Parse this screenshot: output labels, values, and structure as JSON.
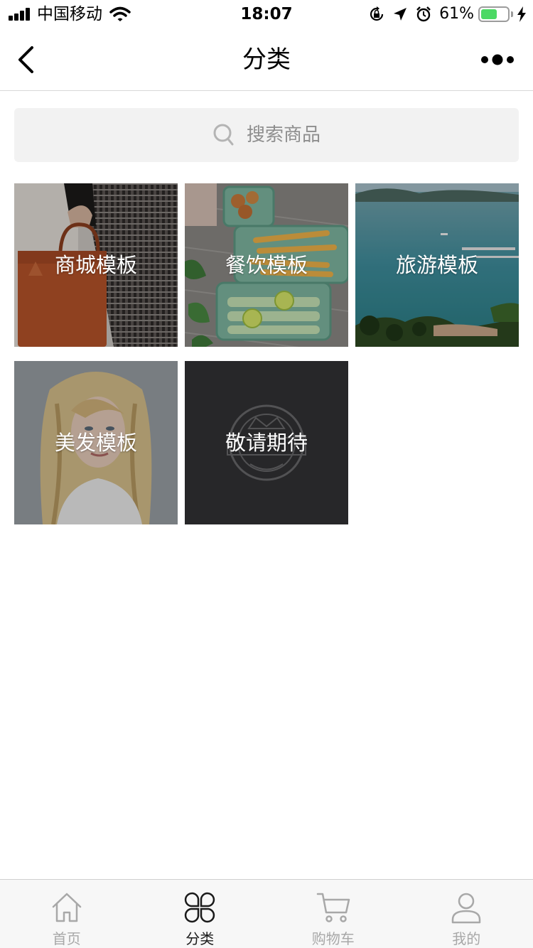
{
  "status_bar": {
    "carrier": "中国移动",
    "time": "18:07",
    "battery": "61%",
    "battery_level": 0.61
  },
  "nav": {
    "title": "分类"
  },
  "search": {
    "placeholder": "搜索商品"
  },
  "categories": [
    {
      "label": "商城模板"
    },
    {
      "label": "餐饮模板"
    },
    {
      "label": "旅游模板"
    },
    {
      "label": "美发模板"
    },
    {
      "label": "敬请期待"
    }
  ],
  "tab_bar": {
    "items": [
      {
        "label": "首页",
        "icon": "home-icon",
        "active": false
      },
      {
        "label": "分类",
        "icon": "category-icon",
        "active": true
      },
      {
        "label": "购物车",
        "icon": "cart-icon",
        "active": false
      },
      {
        "label": "我的",
        "icon": "profile-icon",
        "active": false
      }
    ]
  },
  "colors": {
    "active_tab": "#1a1a1a",
    "inactive_tab": "#a8a8a8",
    "search_bg": "#f2f2f2",
    "battery": "#4cd964"
  }
}
